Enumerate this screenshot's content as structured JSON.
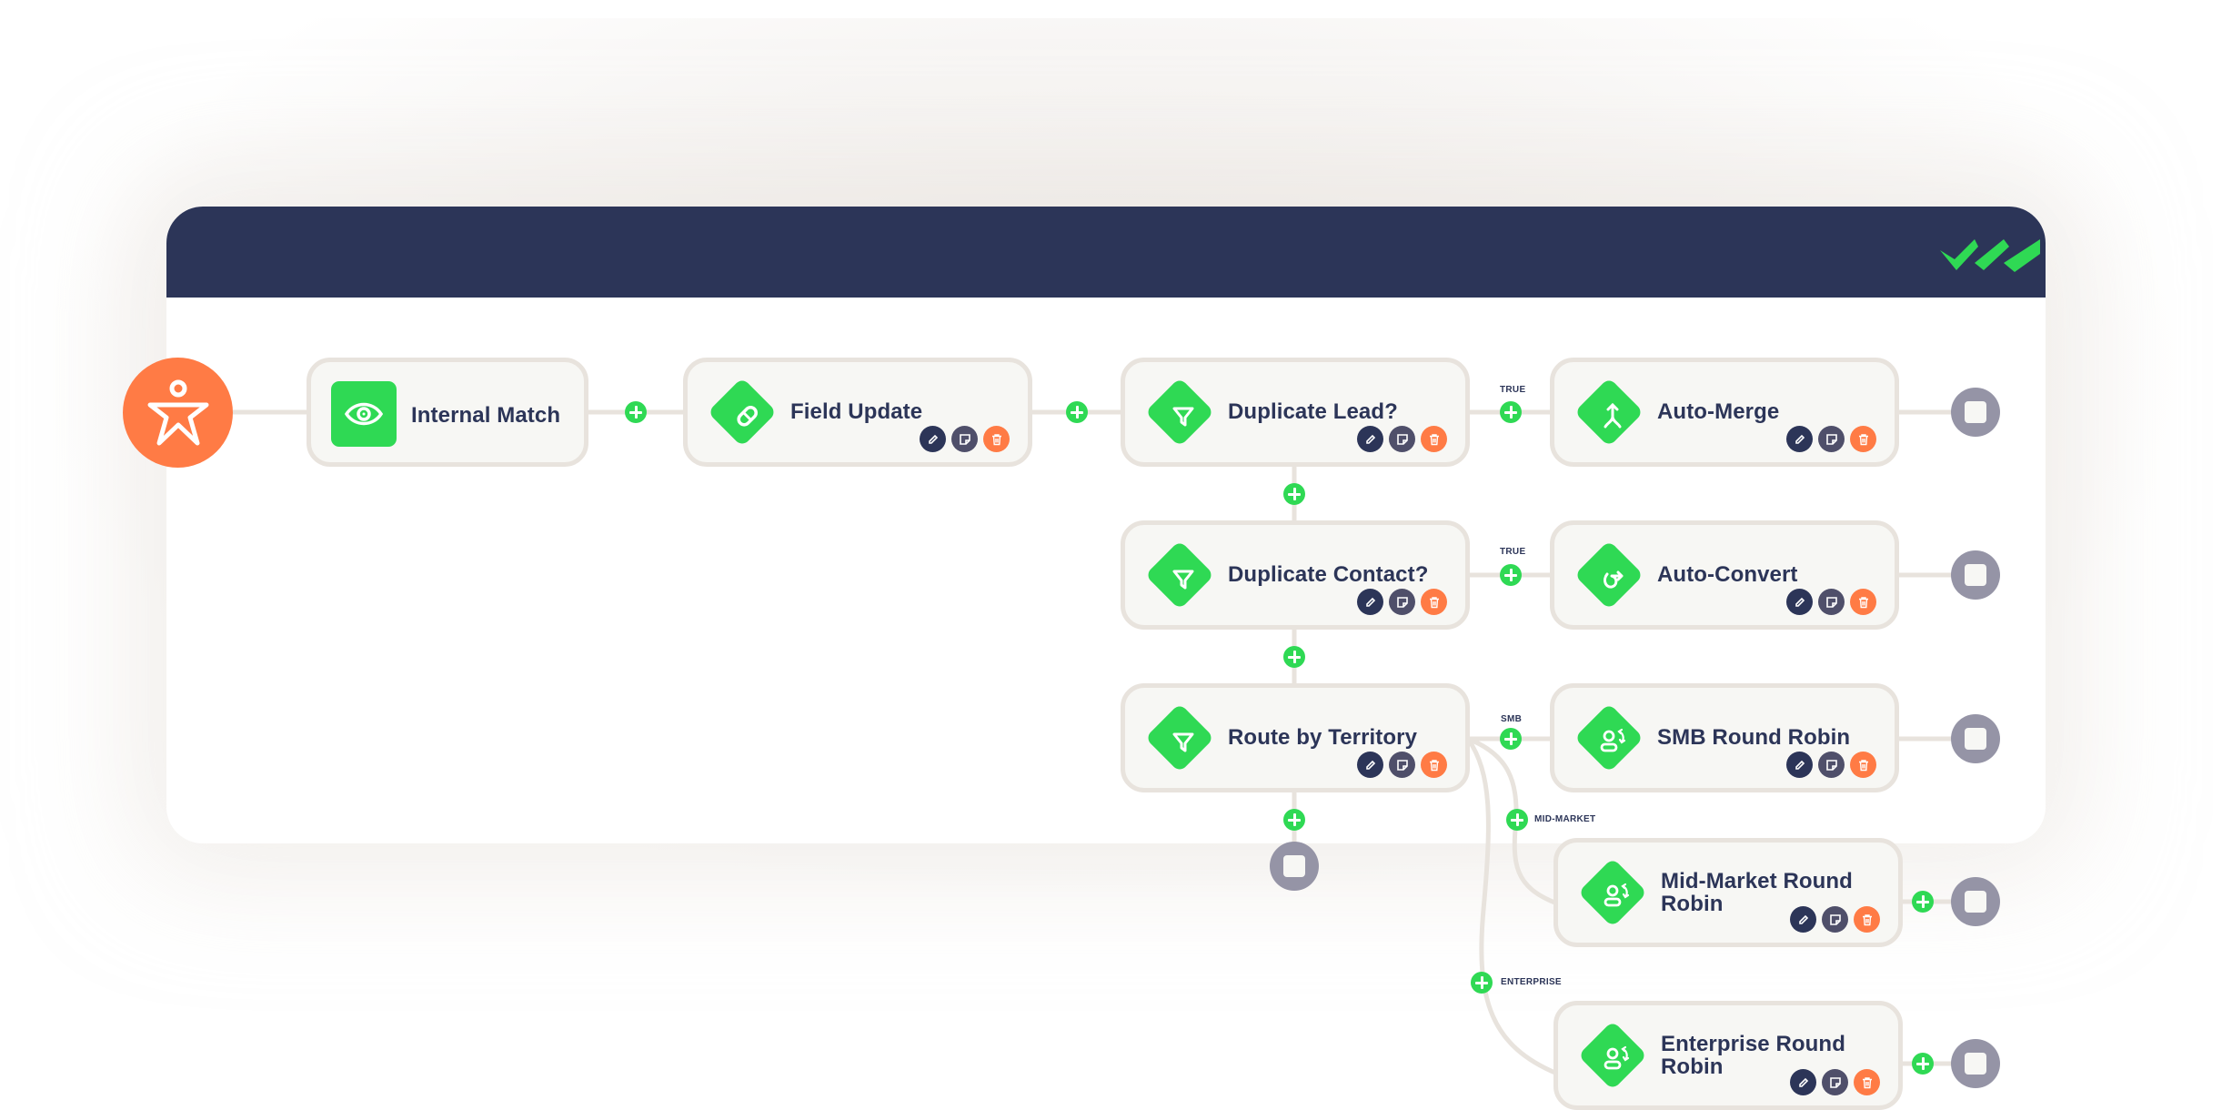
{
  "app": {
    "brand_colors": {
      "header": "#2c3558",
      "accent_green": "#2fd954",
      "start_orange": "#ff7b45",
      "end_gray": "#9594a6",
      "node_bg": "#f7f7f4",
      "node_border": "#e8e3dd"
    },
    "logo_icon": "triple-check-logo-icon"
  },
  "start": {
    "icon": "star-person-icon",
    "label": "Start trigger"
  },
  "nodes": [
    {
      "id": "internal-match",
      "title": "Internal Match",
      "icon": "eye-icon",
      "shape": "square",
      "actions": false
    },
    {
      "id": "field-update",
      "title": "Field Update",
      "icon": "eraser-icon",
      "shape": "diamond",
      "actions": true
    },
    {
      "id": "duplicate-lead",
      "title": "Duplicate Lead?",
      "icon": "filter-icon",
      "shape": "diamond",
      "actions": true
    },
    {
      "id": "auto-merge",
      "title": "Auto-Merge",
      "icon": "merge-icon",
      "shape": "diamond",
      "actions": true
    },
    {
      "id": "duplicate-contact",
      "title": "Duplicate Contact?",
      "icon": "filter-icon",
      "shape": "diamond",
      "actions": true
    },
    {
      "id": "auto-convert",
      "title": "Auto-Convert",
      "icon": "convert-arrow-icon",
      "shape": "diamond",
      "actions": true
    },
    {
      "id": "route-by-territory",
      "title": "Route by Territory",
      "icon": "filter-icon",
      "shape": "diamond",
      "actions": true
    },
    {
      "id": "smb-round-robin",
      "title": "SMB Round Robin",
      "icon": "user-rotate-icon",
      "shape": "diamond",
      "actions": true
    },
    {
      "id": "mid-market-round-robin",
      "title_line1": "Mid-Market Round",
      "title_line2": "Robin",
      "icon": "user-rotate-icon",
      "shape": "diamond",
      "actions": true
    },
    {
      "id": "enterprise-round-robin",
      "title_line1": "Enterprise Round",
      "title_line2": "Robin",
      "icon": "user-rotate-icon",
      "shape": "diamond",
      "actions": true
    }
  ],
  "actions": {
    "edit": {
      "icon": "pencil-icon",
      "label": "Edit"
    },
    "note": {
      "icon": "sticky-note-icon",
      "label": "Note"
    },
    "delete": {
      "icon": "trash-icon",
      "label": "Delete"
    }
  },
  "edge_labels": {
    "lead_true": "TRUE",
    "contact_true": "TRUE",
    "smb": "SMB",
    "mid_market": "MID-MARKET",
    "enterprise": "ENTERPRISE"
  },
  "add_step": {
    "icon": "plus-icon",
    "label": "Add step"
  },
  "end": {
    "icon": "stop-square-icon",
    "label": "End"
  }
}
